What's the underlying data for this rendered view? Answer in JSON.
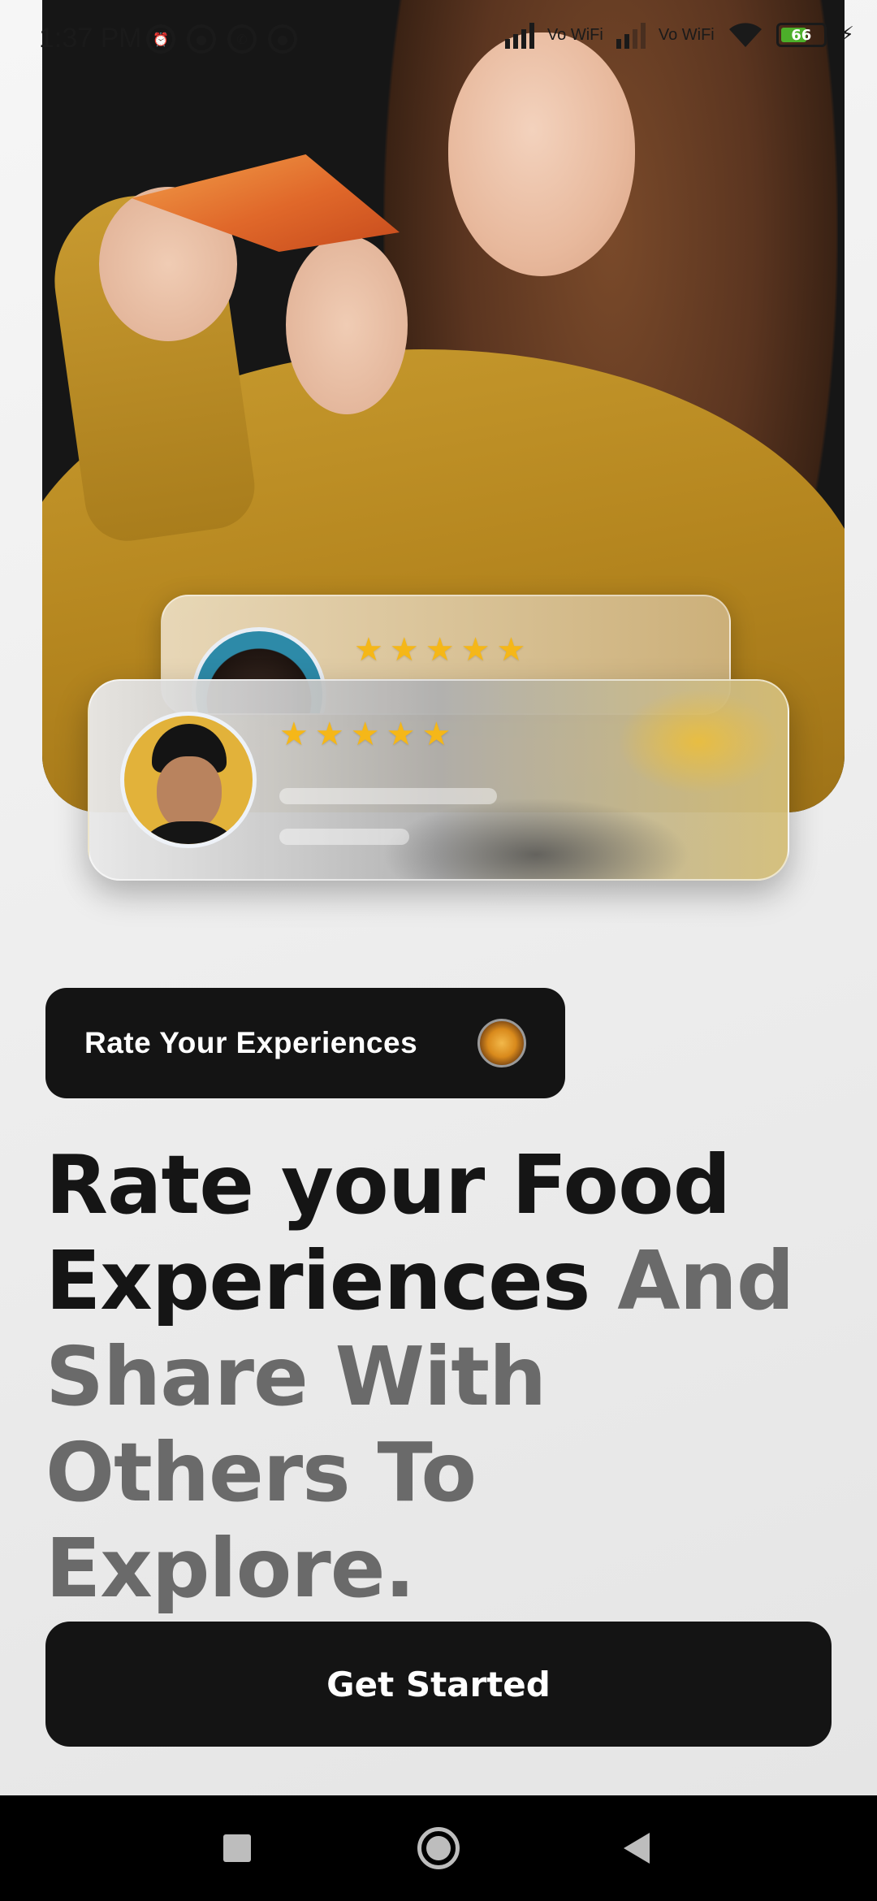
{
  "status_bar": {
    "time": "1:37 PM",
    "battery_level": 66,
    "battery_text": "66",
    "network_labels": [
      "Vo WiFi",
      "Vo WiFi"
    ],
    "icons": [
      "alarm-icon",
      "notification-icon",
      "whatsapp-icon",
      "notification-icon",
      "signal-icon",
      "signal-icon",
      "wifi-icon",
      "battery-icon",
      "charging-icon"
    ]
  },
  "hero": {
    "image": "woman-eating-pizza",
    "reviews": [
      {
        "rating": 5,
        "avatar": "woman-avatar"
      },
      {
        "rating": 5,
        "avatar": "man-avatar"
      }
    ]
  },
  "badge": {
    "label": "Rate Your Experiences",
    "icon": "food-bowl-icon"
  },
  "headline": {
    "dark_line1": "Rate your Food",
    "dark_line2": "Experiences",
    "grey_part": " And Share With Others To Explore."
  },
  "cta": {
    "label": "Get Started"
  },
  "colors": {
    "accent_dark": "#141414",
    "star": "#f5b718",
    "grey_text": "#6a6a6a"
  },
  "nav": {
    "icons": [
      "recents-icon",
      "home-icon",
      "back-icon"
    ]
  }
}
